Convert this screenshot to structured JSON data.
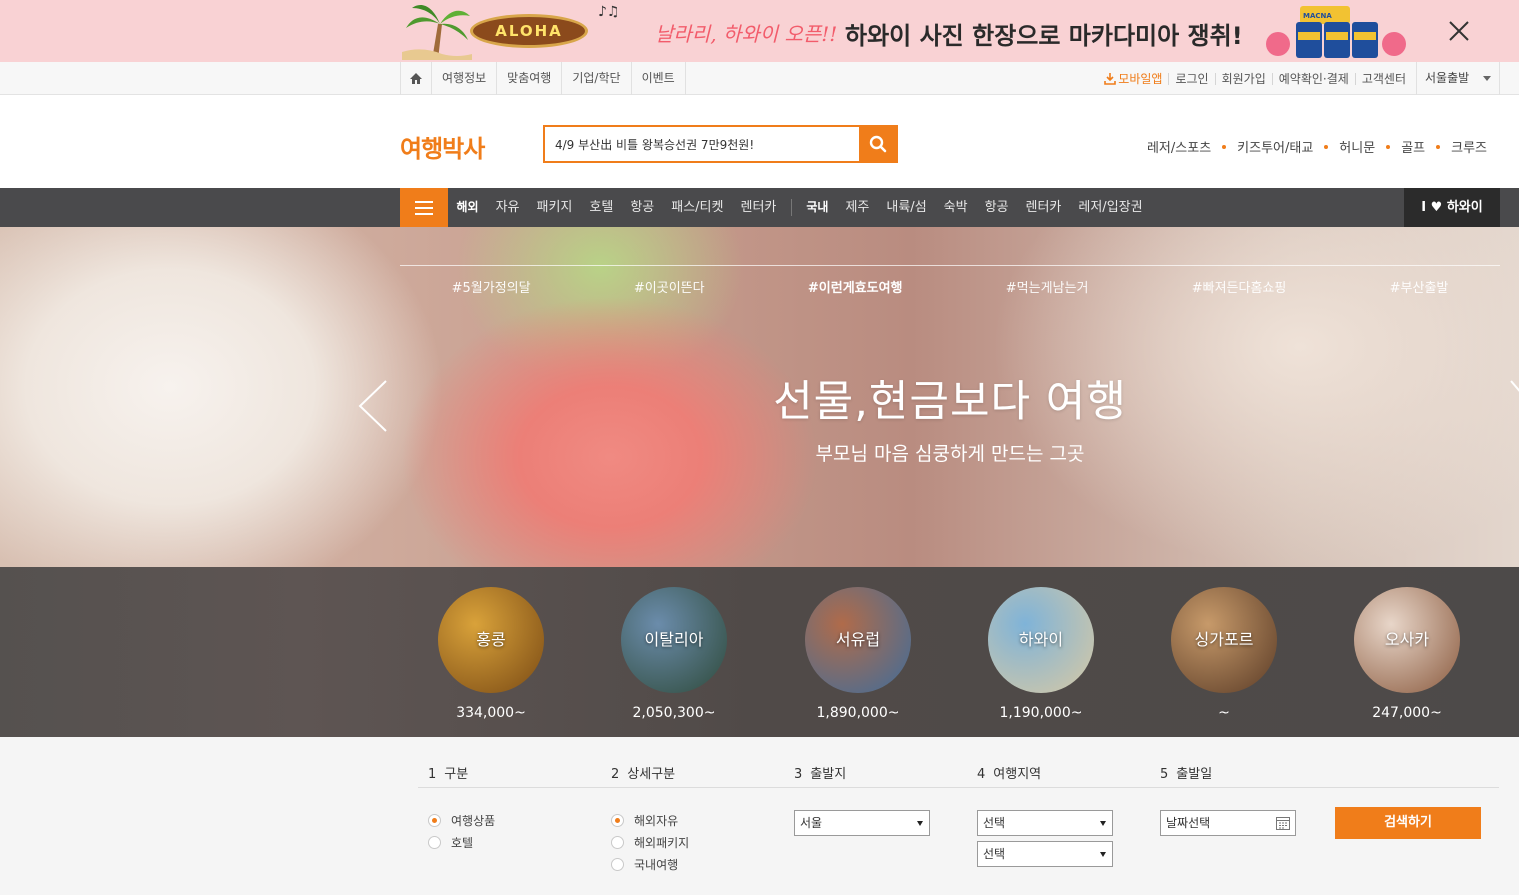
{
  "promo": {
    "aloha_text": "ALOHA",
    "script_text": "날라리, 하와이 오픈!!",
    "headline": "하와이 사진 한장으로 마카다미아 쟁취!",
    "can_label": "MACNA"
  },
  "util": {
    "left_items": [
      "여행정보",
      "맞춤여행",
      "기업/학단",
      "이벤트"
    ],
    "mobile_app": "모바일앱",
    "right_items": [
      "로그인",
      "회원가입",
      "예약확인·결제",
      "고객센터"
    ],
    "departure_city": "서울출발"
  },
  "header": {
    "logo": "여행박사",
    "search_value": "4/9 부산出 비틀 왕복승선권 7만9천원!",
    "quick_links": [
      "레저/스포츠",
      "키즈투어/태교",
      "허니문",
      "골프",
      "크루즈"
    ]
  },
  "gnb": {
    "overseas_head": "해외",
    "overseas_items": [
      "자유",
      "패키지",
      "호텔",
      "항공",
      "패스/티켓",
      "렌터카"
    ],
    "domestic_head": "국내",
    "domestic_items": [
      "제주",
      "내륙/섬",
      "숙박",
      "항공",
      "렌터카",
      "레저/입장권"
    ],
    "hawaii_badge": "I ♥ 하와이"
  },
  "hero": {
    "tags": [
      "#5월가정의달",
      "#이곳이뜬다",
      "#이런게효도여행",
      "#먹는게남는거",
      "#빠져든다홈쇼핑",
      "#부산출발"
    ],
    "active_tag_index": 2,
    "title": "선물,현금보다 여행",
    "subtitle": "부모님 마음 심쿵하게 만드는 그곳"
  },
  "destinations": [
    {
      "name": "홍콩",
      "price": "334,000~",
      "colors": [
        "#d9a23a",
        "#7a4a14"
      ]
    },
    {
      "name": "이탈리아",
      "price": "2,050,300~",
      "colors": [
        "#6b8cab",
        "#2e4a3a"
      ]
    },
    {
      "name": "서유럽",
      "price": "1,890,000~",
      "colors": [
        "#b06b4a",
        "#3f6d9a"
      ]
    },
    {
      "name": "하와이",
      "price": "1,190,000~",
      "colors": [
        "#7fb3d8",
        "#d8c9a4"
      ]
    },
    {
      "name": "싱가포르",
      "price": "~",
      "colors": [
        "#c79a6a",
        "#5a3b26"
      ]
    },
    {
      "name": "오사카",
      "price": "247,000~",
      "colors": [
        "#e8d6c9",
        "#8a5a3e"
      ]
    }
  ],
  "search_panel": {
    "col1": {
      "num": "1",
      "title": "구분",
      "options": [
        "여행상품",
        "호텔"
      ],
      "selected": 0
    },
    "col2": {
      "num": "2",
      "title": "상세구분",
      "options": [
        "해외자유",
        "해외패키지",
        "국내여행"
      ],
      "selected": 0
    },
    "col3": {
      "num": "3",
      "title": "출발지",
      "select_value": "서울"
    },
    "col4": {
      "num": "4",
      "title": "여행지역",
      "select1": "선택",
      "select2": "선택"
    },
    "col5": {
      "num": "5",
      "title": "출발일",
      "date_value": "날짜선택"
    },
    "search_button": "검색하기"
  },
  "colors": {
    "accent": "#f07d1a",
    "gnb_bg": "#4a4a4c",
    "promo_bg": "#f9d2d4"
  }
}
